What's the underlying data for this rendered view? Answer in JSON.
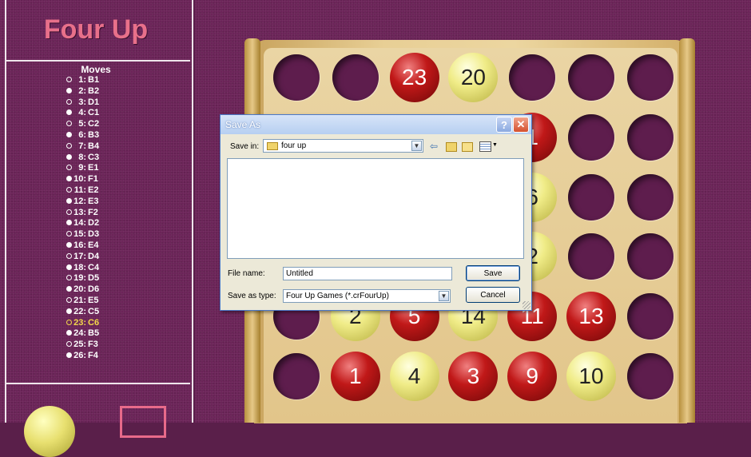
{
  "app": {
    "title": "Four Up"
  },
  "moves": {
    "title": "Moves",
    "current_index": 22,
    "items": [
      {
        "num": "1:",
        "player": "yellow",
        "pos": "B1"
      },
      {
        "num": "2:",
        "player": "red",
        "pos": "B2"
      },
      {
        "num": "3:",
        "player": "yellow",
        "pos": "D1"
      },
      {
        "num": "4:",
        "player": "red",
        "pos": "C1"
      },
      {
        "num": "5:",
        "player": "yellow",
        "pos": "C2"
      },
      {
        "num": "6:",
        "player": "red",
        "pos": "B3"
      },
      {
        "num": "7:",
        "player": "yellow",
        "pos": "B4"
      },
      {
        "num": "8:",
        "player": "red",
        "pos": "C3"
      },
      {
        "num": "9:",
        "player": "yellow",
        "pos": "E1"
      },
      {
        "num": "10:",
        "player": "red",
        "pos": "F1"
      },
      {
        "num": "11:",
        "player": "yellow",
        "pos": "E2"
      },
      {
        "num": "12:",
        "player": "red",
        "pos": "E3"
      },
      {
        "num": "13:",
        "player": "yellow",
        "pos": "F2"
      },
      {
        "num": "14:",
        "player": "red",
        "pos": "D2"
      },
      {
        "num": "15:",
        "player": "yellow",
        "pos": "D3"
      },
      {
        "num": "16:",
        "player": "red",
        "pos": "E4"
      },
      {
        "num": "17:",
        "player": "yellow",
        "pos": "D4"
      },
      {
        "num": "18:",
        "player": "red",
        "pos": "C4"
      },
      {
        "num": "19:",
        "player": "yellow",
        "pos": "D5"
      },
      {
        "num": "20:",
        "player": "red",
        "pos": "D6"
      },
      {
        "num": "21:",
        "player": "yellow",
        "pos": "E5"
      },
      {
        "num": "22:",
        "player": "red",
        "pos": "C5"
      },
      {
        "num": "23:",
        "player": "yellow",
        "pos": "C6"
      },
      {
        "num": "24:",
        "player": "red",
        "pos": "B5"
      },
      {
        "num": "25:",
        "player": "yellow",
        "pos": "F3"
      },
      {
        "num": "26:",
        "player": "red",
        "pos": "F4"
      }
    ]
  },
  "board": {
    "columns": 7,
    "rows": 6,
    "visible_balls": [
      {
        "row": 0,
        "col": 2,
        "color": "red",
        "label": "23"
      },
      {
        "row": 0,
        "col": 3,
        "color": "yellow",
        "label": "20"
      },
      {
        "row": 1,
        "col": 4,
        "color": "red",
        "label": "1"
      },
      {
        "row": 2,
        "col": 4,
        "color": "yellow",
        "label": "6"
      },
      {
        "row": 3,
        "col": 4,
        "color": "yellow",
        "label": "2"
      },
      {
        "row": 4,
        "col": 1,
        "color": "yellow",
        "label": "2"
      },
      {
        "row": 4,
        "col": 2,
        "color": "red",
        "label": "5"
      },
      {
        "row": 4,
        "col": 3,
        "color": "yellow",
        "label": "14"
      },
      {
        "row": 4,
        "col": 4,
        "color": "red",
        "label": "11"
      },
      {
        "row": 4,
        "col": 5,
        "color": "red",
        "label": "13"
      },
      {
        "row": 5,
        "col": 1,
        "color": "red",
        "label": "1"
      },
      {
        "row": 5,
        "col": 2,
        "color": "yellow",
        "label": "4"
      },
      {
        "row": 5,
        "col": 3,
        "color": "red",
        "label": "3"
      },
      {
        "row": 5,
        "col": 4,
        "color": "red",
        "label": "9"
      },
      {
        "row": 5,
        "col": 5,
        "color": "yellow",
        "label": "10"
      }
    ]
  },
  "dialog": {
    "title": "Save As",
    "help_label": "?",
    "close_label": "✕",
    "save_in_label": "Save in:",
    "save_in_value": "four up",
    "file_name_label": "File name:",
    "file_name_value": "Untitled",
    "save_as_type_label": "Save as type:",
    "save_as_type_value": "Four Up Games (*.crFourUp)",
    "save_button": "Save",
    "cancel_button": "Cancel",
    "icons": [
      "back-arrow-icon",
      "up-folder-icon",
      "new-folder-icon",
      "view-menu-icon"
    ]
  }
}
